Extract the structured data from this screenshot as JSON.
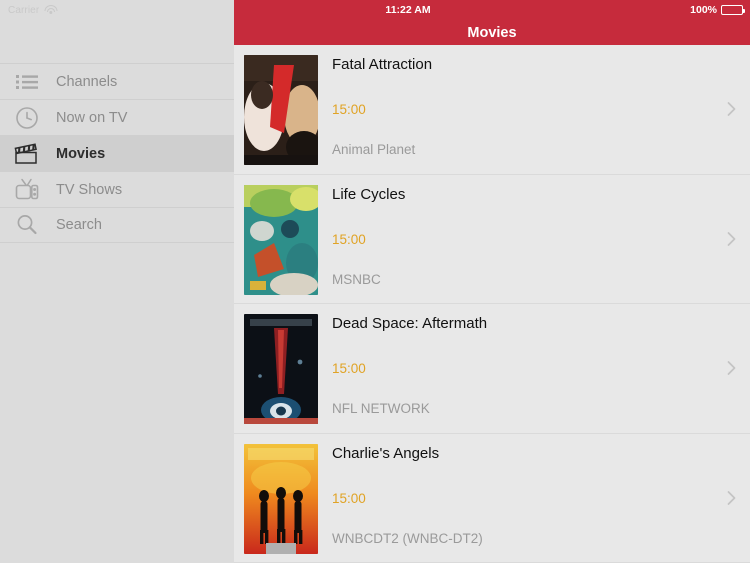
{
  "status": {
    "carrier": "Carrier",
    "wifi_icon": "wifi-icon",
    "time": "11:22 AM",
    "battery_percent": "100%",
    "battery_icon": "battery-full-icon"
  },
  "theme": {
    "navbar_red": "#c62b3c",
    "sidebar_bg": "#dcdcdc",
    "content_bg": "#e8e8e8",
    "time_accent": "#e0a325",
    "channel_gray": "#9a9a9a"
  },
  "sidebar": {
    "items": [
      {
        "label": "Channels",
        "icon": "list-icon",
        "active": false
      },
      {
        "label": "Now on TV",
        "icon": "clock-icon",
        "active": false
      },
      {
        "label": "Movies",
        "icon": "clapperboard-icon",
        "active": true
      },
      {
        "label": "TV Shows",
        "icon": "television-icon",
        "active": false
      },
      {
        "label": "Search",
        "icon": "search-icon",
        "active": false
      }
    ]
  },
  "navbar": {
    "title": "Movies"
  },
  "list": {
    "items": [
      {
        "title": "Fatal Attraction",
        "time": "15:00",
        "channel": "Animal Planet",
        "poster": "fatal-attraction-poster",
        "chevron": "chevron-right-icon"
      },
      {
        "title": "Life Cycles",
        "time": "15:00",
        "channel": "MSNBC",
        "poster": "life-cycles-poster",
        "chevron": "chevron-right-icon"
      },
      {
        "title": "Dead Space: Aftermath",
        "time": "15:00",
        "channel": "NFL NETWORK",
        "poster": "dead-space-aftermath-poster",
        "chevron": "chevron-right-icon"
      },
      {
        "title": "Charlie's Angels",
        "time": "15:00",
        "channel": "WNBCDT2 (WNBC-DT2)",
        "poster": "charlies-angels-poster",
        "chevron": "chevron-right-icon"
      }
    ]
  }
}
